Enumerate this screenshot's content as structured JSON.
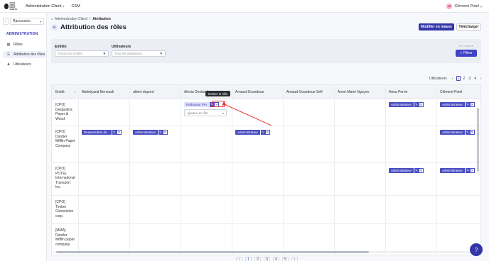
{
  "topbar": {
    "logo_text": [
      "DATA",
      "GRIS",
      "DIGIT",
      "RONTA"
    ],
    "menu": [
      {
        "label": "Administration Client"
      },
      {
        "label": "CSM"
      }
    ],
    "user": {
      "initials": "CP",
      "name": "Clément Potel"
    }
  },
  "sidebar": {
    "shortcut": "Raccourcis",
    "collapse": "‹",
    "section": "ADMINISTRATION",
    "items": [
      {
        "label": "Rôles",
        "icon": "grid-icon"
      },
      {
        "label": "Attribution des rôles",
        "icon": "list-icon"
      },
      {
        "label": "Utilisateurs",
        "icon": "users-icon"
      }
    ]
  },
  "breadcrumb": {
    "home": "Administration Client",
    "sep": "/",
    "current": "Attribution"
  },
  "page": {
    "title": "Attribution des rôles",
    "bulk_edit": "Modifier en masse",
    "download": "Télécharger"
  },
  "filters": {
    "entities_label": "Entités",
    "entities_placeholder": "Toutes les entités",
    "users_label": "Utilisateurs",
    "users_placeholder": "Tous les utilisateurs",
    "reset": "Réinitialiser",
    "apply": "Filtrer"
  },
  "pagination": {
    "label": "Utilisateurs",
    "prev": "‹",
    "next": "›",
    "pages": [
      "1",
      "2",
      "3",
      "4"
    ],
    "bottom_pages": [
      "1",
      "2",
      "3",
      "4",
      "5",
      "6"
    ]
  },
  "table": {
    "entity_header": "Entité",
    "sort_icon": "↑",
    "columns": [
      "Abdelyazid Benouali",
      "albert dupont",
      "Alexia Deslandes",
      "Arnaud Goasdoue",
      "Arnaud Goasdoue Self",
      "Anne-Marie Nguyen",
      "Anna Perrin",
      "Clément Potel"
    ],
    "rows": [
      {
        "entity": "[CPO] Desjardins Paper & Wood"
      },
      {
        "entity": "[CPO] Dunder Mifflin Paper Company"
      },
      {
        "entity": "[CPO] POTEL International Transport Inc."
      },
      {
        "entity": "[CPO] Timber Connection corp."
      },
      {
        "entity": "[MMA] Dunder Mifflin paper company"
      }
    ],
    "chips": {
      "administrateur": "Administrateur",
      "responsable": "Responsable dir...",
      "redacteur": "Rédacteur PIA"
    },
    "add_role_placeholder": "Ajouter un rôle",
    "tooltip": "Retirer le rôle",
    "edit_icon": "✎",
    "delete_icon": "✕"
  },
  "help_icon": "?"
}
